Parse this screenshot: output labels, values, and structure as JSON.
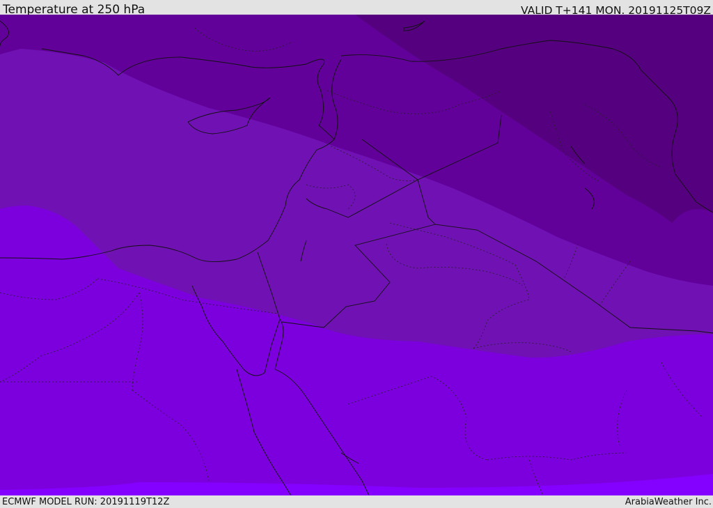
{
  "header": {
    "title": "Temperature at 250 hPa",
    "valid_time": "VALID T+141 MON. 20191125T09Z"
  },
  "footer": {
    "model_run": "ECMWF MODEL RUN: 20191119T12Z",
    "credit": "ArabiaWeather Inc."
  },
  "map": {
    "color_bands": [
      "#55007f",
      "#62009a",
      "#7011b3",
      "#7c00dd",
      "#8400ff"
    ]
  }
}
